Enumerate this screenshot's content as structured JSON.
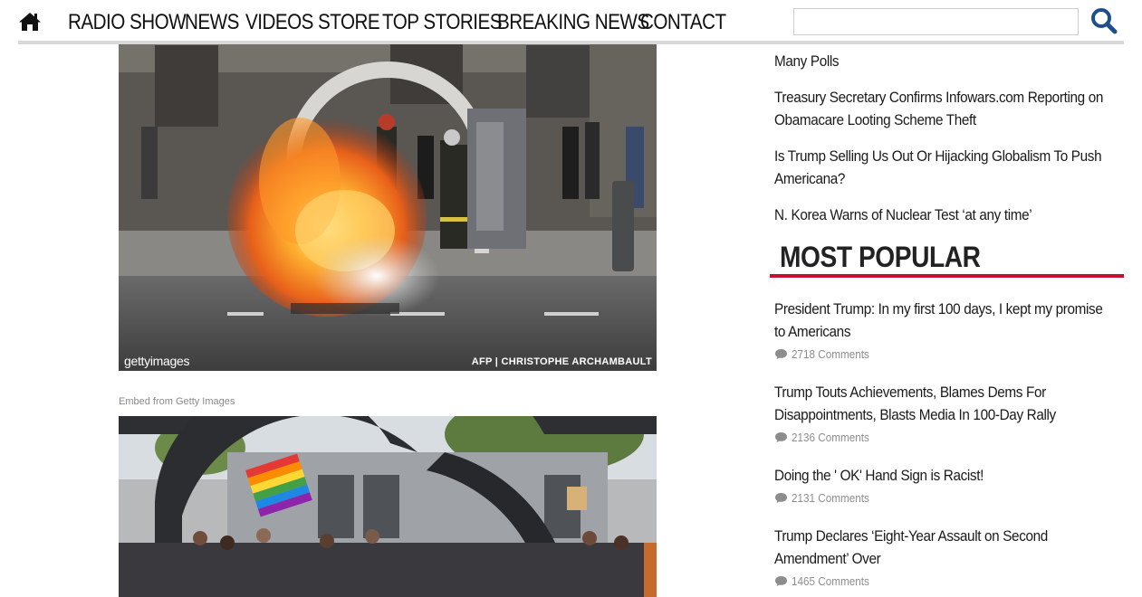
{
  "nav": {
    "items": [
      {
        "label": "RADIO SHOW"
      },
      {
        "label": "NEWS"
      },
      {
        "label": "VIDEOS"
      },
      {
        "label": "STORE"
      },
      {
        "label": "TOP STORIES"
      },
      {
        "label": "BREAKING NEWS"
      },
      {
        "label": "CONTACT"
      }
    ],
    "search_value": "",
    "home_icon": "home-icon",
    "search_icon": "magnifier-icon"
  },
  "photos": {
    "first": {
      "watermark": "gettyimages",
      "credit": "AFP | CHRISTOPHE ARCHAMBAULT"
    },
    "embed_caption": "Embed from Getty Images"
  },
  "sidebar": {
    "latest": [
      {
        "title": "Many Polls"
      },
      {
        "title": "Treasury Secretary Confirms Infowars.com Reporting on Obamacare Looting Scheme Theft"
      },
      {
        "title": "Is Trump Selling Us Out Or Hijacking Globalism To Push Americana?"
      },
      {
        "title": "N. Korea Warns of Nuclear Test ‘at any time’"
      }
    ],
    "most_popular_title": "MOST POPULAR",
    "popular": [
      {
        "title": "President Trump: In my first 100 days, I kept my promise to Americans",
        "comments": "2718 Comments"
      },
      {
        "title": "Trump Touts Achievements, Blames Dems For Disappointments, Blasts Media In 100-Day Rally",
        "comments": "2136 Comments"
      },
      {
        "title": "Doing the ' OK' Hand Sign is Racist!",
        "comments": "2131 Comments"
      },
      {
        "title": "Trump Declares ‘Eight-Year Assault on Second Amendment’ Over",
        "comments": "1465 Comments"
      }
    ]
  },
  "colors": {
    "accent_red": "#c8102e",
    "nav_icon_blue": "#1f4e8c",
    "text": "#1a1a1a",
    "muted": "#8d8d8d"
  }
}
